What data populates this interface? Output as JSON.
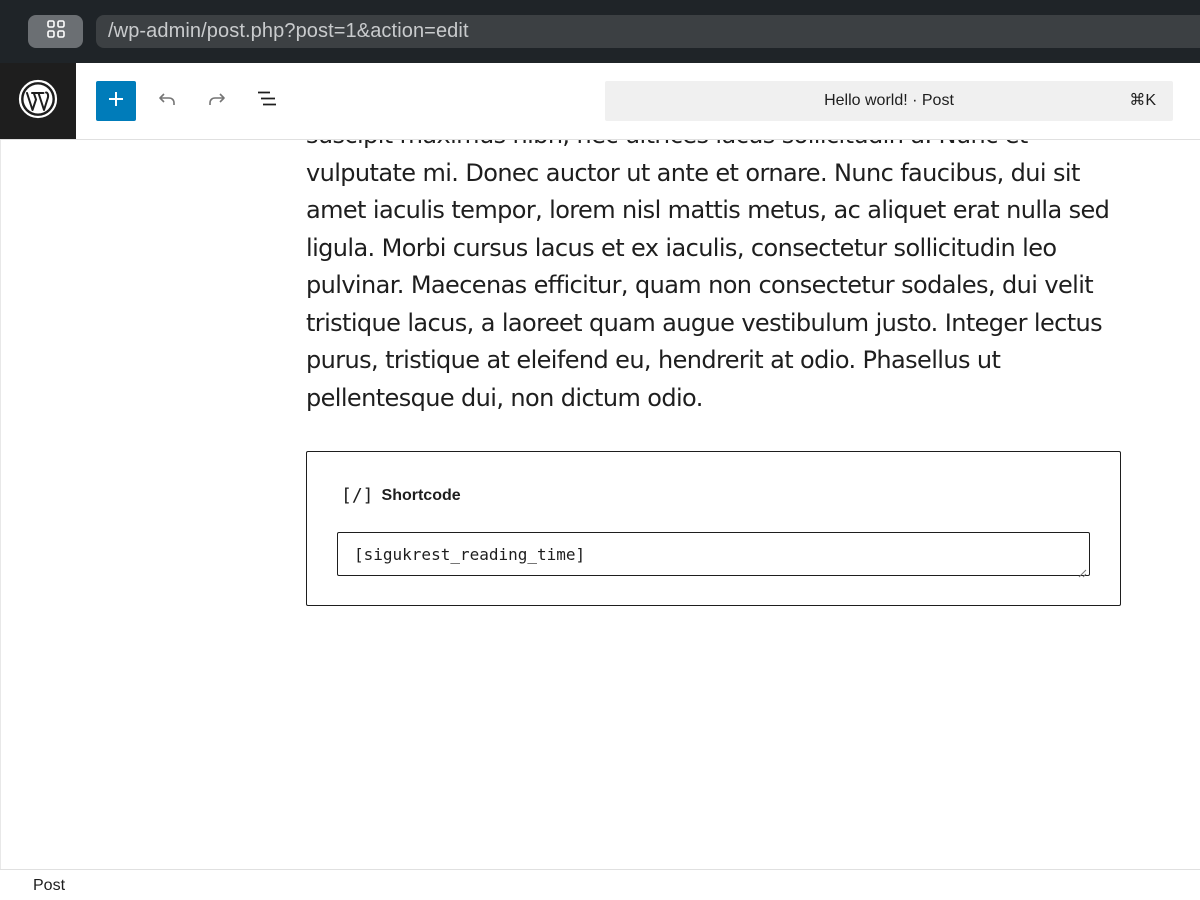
{
  "browser": {
    "url": "/wp-admin/post.php?post=1&action=edit",
    "tabs_icon": "grid-icon"
  },
  "header": {
    "logo_icon": "wordpress-logo-icon",
    "add_block_icon": "plus-icon",
    "undo_icon": "undo-icon",
    "redo_icon": "redo-icon",
    "list_view_icon": "list-view-icon",
    "command_title": "Hello world! · Post",
    "command_shortcut": "⌘K",
    "accent_color": "#007cba"
  },
  "content": {
    "paragraph": "suscipit maximus nibh, nec ultrices lacus sollicitudin a. Nunc et vulputate mi. Donec auctor ut ante et ornare. Nunc faucibus, dui sit amet iaculis tempor, lorem nisl mattis metus, ac aliquet erat nulla sed ligula. Morbi cursus lacus et ex iaculis, consectetur sollicitudin leo pulvinar. Maecenas efficitur, quam non consectetur sodales, dui velit tristique lacus, a laoreet quam augue vestibulum justo. Integer lectus purus, tristique at eleifend eu, hendrerit at odio. Phasellus ut pellentesque dui, non dictum odio.",
    "shortcode_block": {
      "icon": "[/]",
      "label": "Shortcode",
      "value": "[sigukrest_reading_time]"
    }
  },
  "footer": {
    "breadcrumb": "Post"
  }
}
